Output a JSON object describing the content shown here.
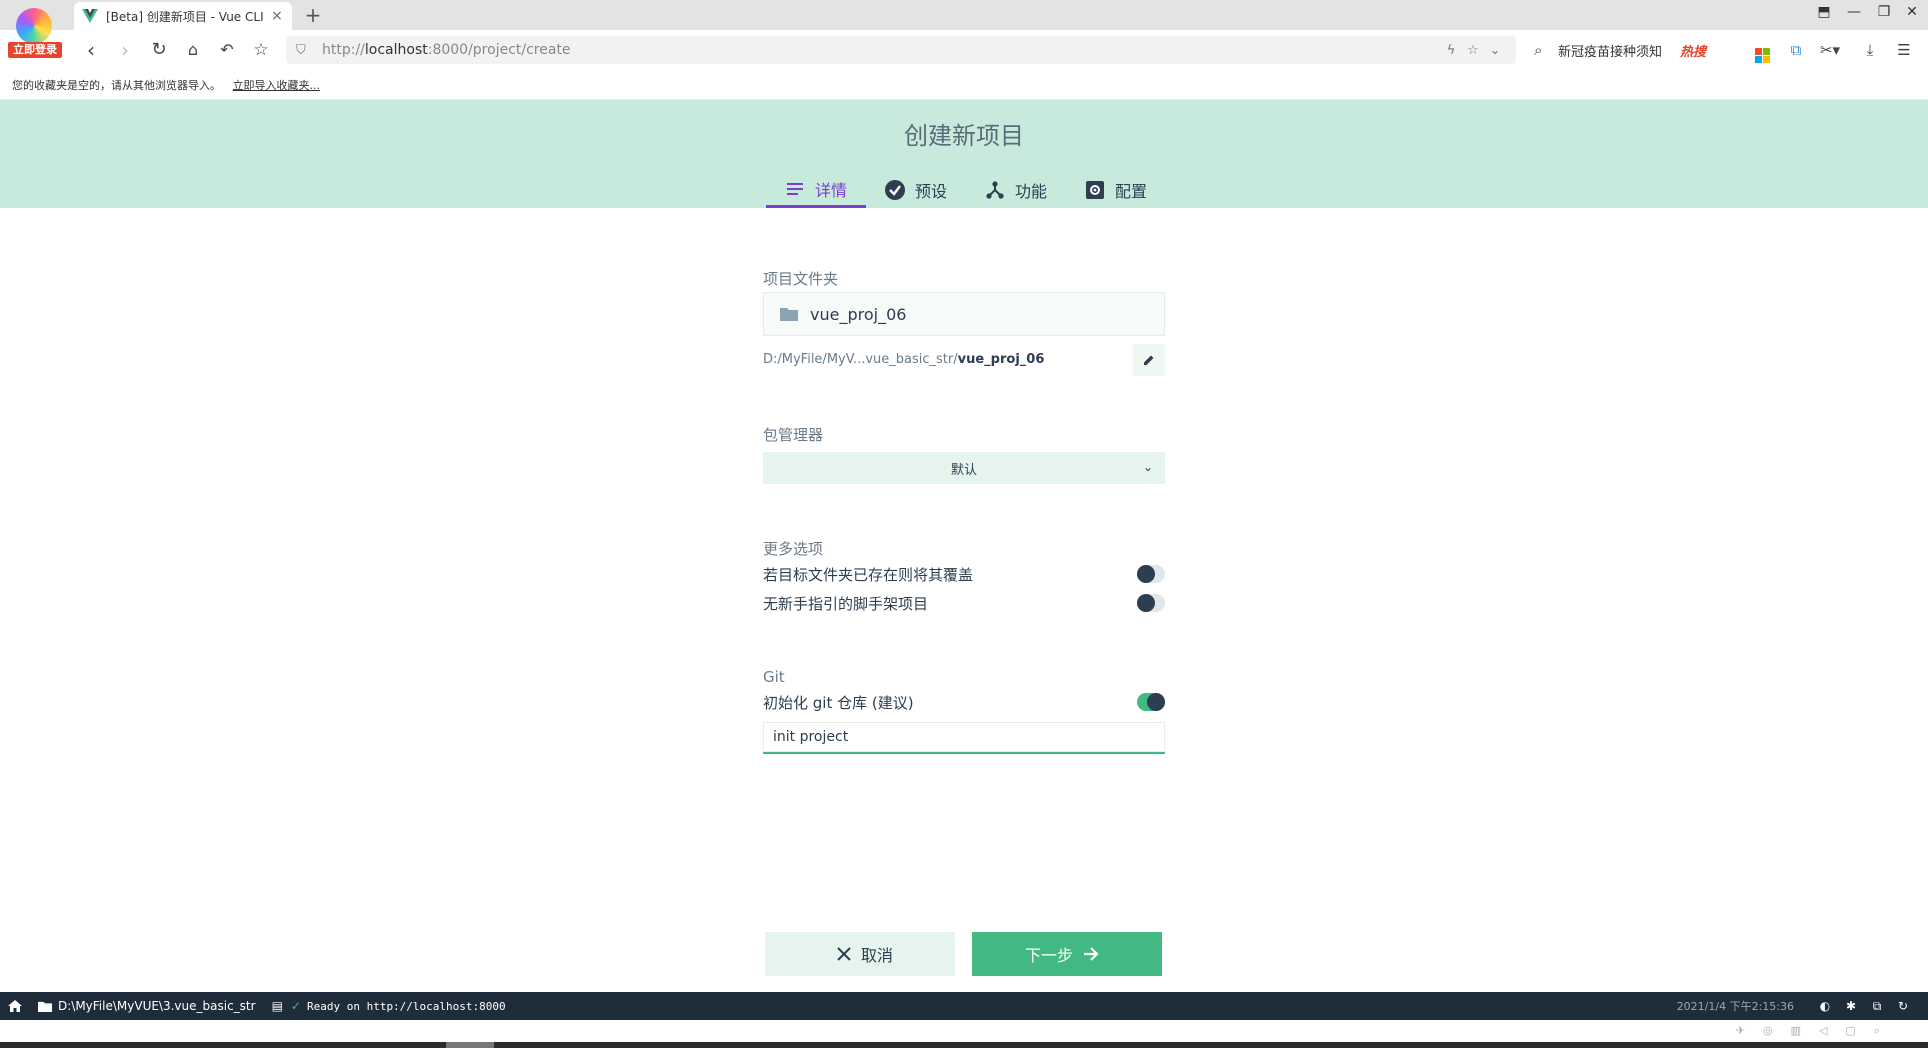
{
  "browser": {
    "login_badge": "立即登录",
    "tab_title": "[Beta] 创建新项目 - Vue CLI",
    "url_prefix": "http://",
    "url_host": "localhost",
    "url_rest": ":8000/project/create",
    "search_text": "新冠疫苗接种须知",
    "hot_label": "热搜",
    "bookmarks_text": "您的收藏夹是空的，请从其他浏览器导入。",
    "bookmarks_link": "立即导入收藏夹..."
  },
  "header": {
    "title": "创建新项目",
    "steps": [
      {
        "label": "详情",
        "icon": "details-icon",
        "active": true
      },
      {
        "label": "预设",
        "icon": "check-circle-icon",
        "active": false
      },
      {
        "label": "功能",
        "icon": "fork-icon",
        "active": false
      },
      {
        "label": "配置",
        "icon": "settings-box-icon",
        "active": false
      }
    ]
  },
  "form": {
    "folder_label": "项目文件夹",
    "folder_value": "vue_proj_06",
    "path_prefix": "D:/MyFile/MyV...vue_basic_str/",
    "path_folder": "vue_proj_06",
    "pm_label": "包管理器",
    "pm_value": "默认",
    "more_label": "更多选项",
    "opt_overwrite": "若目标文件夹已存在则将其覆盖",
    "opt_overwrite_on": false,
    "opt_bare": "无新手指引的脚手架项目",
    "opt_bare_on": false,
    "git_label": "Git",
    "git_init": "初始化 git 仓库 (建议)",
    "git_init_on": true,
    "commit_message": "init project"
  },
  "actions": {
    "cancel": "取消",
    "next": "下一步"
  },
  "statusbar": {
    "cwd": "D:\\MyFile\\MyVUE\\3.vue_basic_str",
    "log": "Ready on http://localhost:8000",
    "time": "2021/1/4 下午2:15:36"
  },
  "colors": {
    "header_bg": "#c7eadd",
    "accent_green": "#42b983",
    "active_step": "#7b3fcf",
    "statusbar_bg": "#1f2d3a"
  }
}
